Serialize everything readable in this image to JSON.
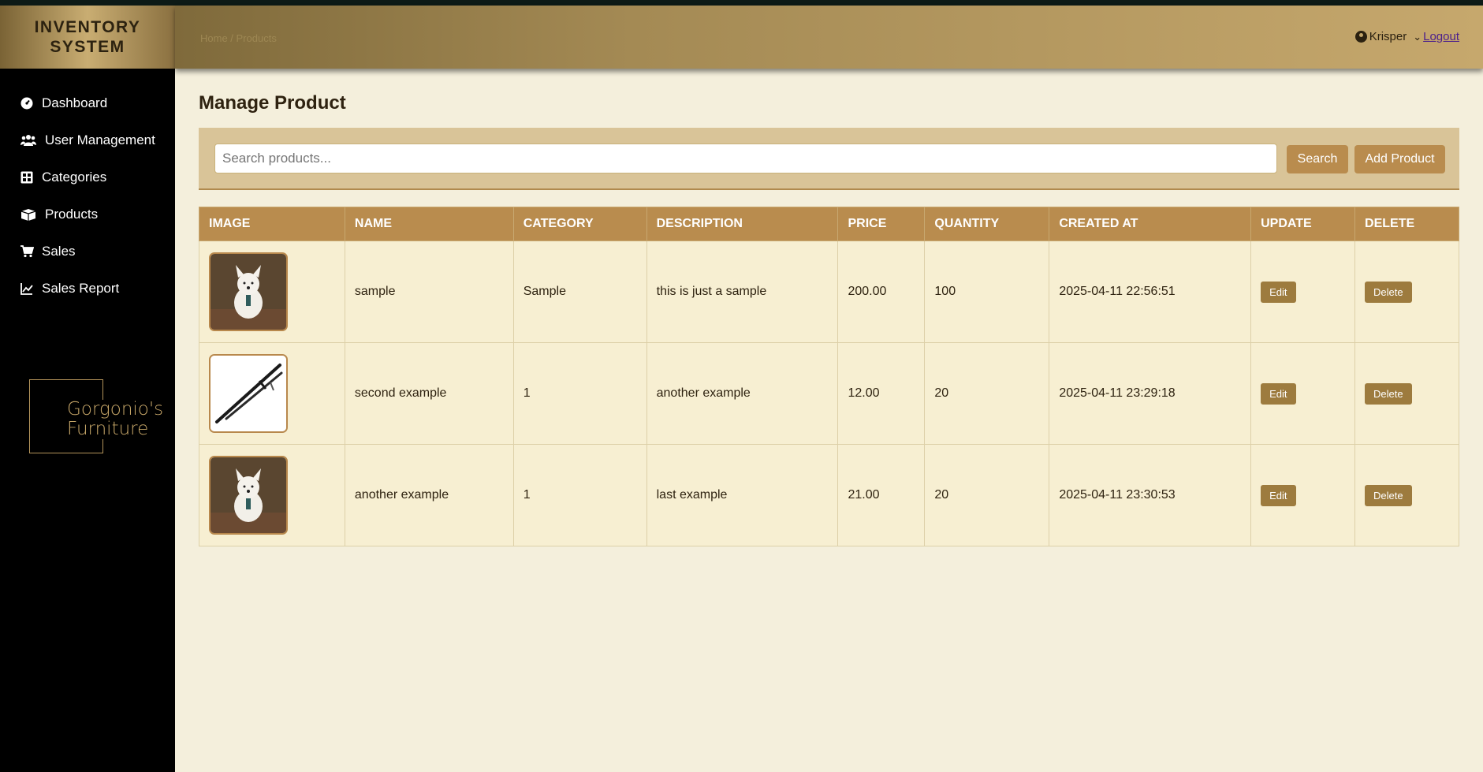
{
  "app": {
    "title_line1": "INVENTORY",
    "title_line2": "SYSTEM"
  },
  "header": {
    "breadcrumb": "Home / Products",
    "username": "Krisper",
    "logout_label": "Logout"
  },
  "sidebar": {
    "items": [
      {
        "label": "Dashboard",
        "icon": "dashboard-icon"
      },
      {
        "label": "User Management",
        "icon": "users-icon"
      },
      {
        "label": "Categories",
        "icon": "grid-icon"
      },
      {
        "label": "Products",
        "icon": "box-icon"
      },
      {
        "label": "Sales",
        "icon": "cart-icon"
      },
      {
        "label": "Sales Report",
        "icon": "chart-line-icon"
      }
    ],
    "logo_line1": "Gorgonio's",
    "logo_line2": "Furniture"
  },
  "main": {
    "page_title": "Manage Product",
    "search": {
      "placeholder": "Search products...",
      "value": "",
      "search_label": "Search",
      "add_label": "Add Product"
    },
    "table": {
      "columns": [
        "IMAGE",
        "NAME",
        "CATEGORY",
        "DESCRIPTION",
        "PRICE",
        "QUANTITY",
        "CREATED AT",
        "UPDATE",
        "DELETE"
      ],
      "rows": [
        {
          "image": "dog-photo",
          "name": "sample",
          "category": "Sample",
          "description": "this is just a sample",
          "price": "200.00",
          "quantity": "100",
          "created_at": "2025-04-11 22:56:51",
          "edit_label": "Edit",
          "delete_label": "Delete"
        },
        {
          "image": "sword-photo",
          "name": "second example",
          "category": "1",
          "description": "another example",
          "price": "12.00",
          "quantity": "20",
          "created_at": "2025-04-11 23:29:18",
          "edit_label": "Edit",
          "delete_label": "Delete"
        },
        {
          "image": "dog-photo",
          "name": "another example",
          "category": "1",
          "description": "last example",
          "price": "21.00",
          "quantity": "20",
          "created_at": "2025-04-11 23:30:53",
          "edit_label": "Edit",
          "delete_label": "Delete"
        }
      ]
    }
  },
  "colors": {
    "accent": "#b98c4e",
    "sidebar_bg": "#000000",
    "page_bg": "#f4efdc",
    "row_bg": "#f7efd2"
  }
}
